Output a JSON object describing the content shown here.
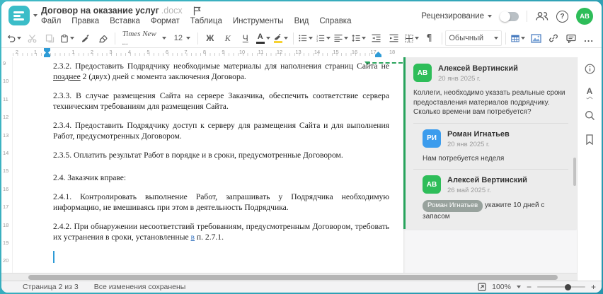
{
  "titlebar": {
    "doc_title": "Договор на оказание услуг",
    "doc_ext": ".docx",
    "menu": [
      "Файл",
      "Правка",
      "Вставка",
      "Формат",
      "Таблица",
      "Инструменты",
      "Вид",
      "Справка"
    ],
    "review_label": "Рецензирование",
    "avatar_initials": "АВ",
    "avatar_color": "#2ebd59"
  },
  "toolbar": {
    "font_name": "Times New ...",
    "font_size": "12",
    "bold_label": "Ж",
    "italic_label": "К",
    "underline_label": "Ч",
    "font_color_label": "А",
    "style_name": "Обычный",
    "pilcrow": "¶",
    "more_label": "..."
  },
  "icons": {
    "logo": "hamburger-lines",
    "flag-icon": "flag-outline",
    "undo-icon": "arrow-ccw",
    "cut-icon": "scissors",
    "copy-icon": "two-pages",
    "paste-icon": "clipboard",
    "format-painter-icon": "brush",
    "clear-style-icon": "eraser",
    "bullet-list-icon": "dots-lines",
    "numbered-list-icon": "digits-lines",
    "align-icon": "left-lines",
    "line-spacing-icon": "arrow-lines",
    "outdent-icon": "arrow-left-lines",
    "indent-icon": "arrow-right-lines",
    "shading-icon": "dashed-box",
    "table-icon": "blue-grid",
    "image-icon": "blue-picture",
    "link-icon": "chain",
    "comment-icon": "speech-bubble",
    "people-icon": "two-users",
    "help-icon": "?",
    "info-icon": "i-circle",
    "spellcheck-icon": "A-wavy",
    "search-icon": "magnifier",
    "bookmark-icon": "bookmark",
    "fit-width-icon": "square-diagonal-arrow"
  },
  "hruler": {
    "left_numbers": [
      "2",
      "1"
    ],
    "numbers": [
      "1",
      "2",
      "3",
      "4",
      "5",
      "6",
      "7",
      "8",
      "9",
      "10",
      "11",
      "12",
      "13",
      "14",
      "15",
      "16",
      "17",
      "18"
    ]
  },
  "vruler": {
    "numbers": [
      "9",
      "10",
      "11",
      "12",
      "13",
      "14",
      "15",
      "16",
      "17",
      "18",
      "19",
      "20"
    ]
  },
  "document": {
    "paragraphs": [
      {
        "gap": false,
        "segments": [
          {
            "t": "2.3.2. Предоставить Подрядчику необходимые материалы для наполнения страниц Сайта не ",
            "s": ""
          },
          {
            "t": "позднее",
            "s": "u"
          },
          {
            "t": " 2 (двух) дней с момента заключения Договора.",
            "s": ""
          }
        ]
      },
      {
        "gap": false,
        "segments": [
          {
            "t": "2.3.3. В случае размещения Сайта на сервере Заказчика, обеспечить соответствие сервера техническим требованиям для размещения Сайта.",
            "s": ""
          }
        ]
      },
      {
        "gap": false,
        "segments": [
          {
            "t": "2.3.4. Предоставить Подрядчику доступ к серверу для размещения Сайта и для выполнения Работ, предусмотренных Договором.",
            "s": ""
          }
        ]
      },
      {
        "gap": false,
        "segments": [
          {
            "t": "2.3.5. Оплатить результат Работ в порядке и в сроки, предусмотренные Договором.",
            "s": ""
          }
        ]
      },
      {
        "gap": true,
        "segments": [
          {
            "t": "2.4. Заказчик вправе:",
            "s": ""
          }
        ]
      },
      {
        "gap": false,
        "segments": [
          {
            "t": "2.4.1. Контролировать выполнение Работ, запрашивать у Подрядчика необходимую информацию, не вмешиваясь при этом в деятельность Подрядчика.",
            "s": ""
          }
        ]
      },
      {
        "gap": false,
        "segments": [
          {
            "t": "2.4.2. При обнаружении несоответствий требованиям, предусмотренным Договором, требовать их устранения в сроки, установленные ",
            "s": ""
          },
          {
            "t": "в",
            "s": "link"
          },
          {
            "t": " п. 2.7.1.",
            "s": ""
          }
        ]
      }
    ]
  },
  "comments": {
    "items": [
      {
        "initials": "АВ",
        "color": "#2ebd59",
        "name": "Алексей Вертинский",
        "date": "20 янв 2025 г.",
        "text": "Коллеги, необходимо указать реальные сроки предоставления материалов подрядчику. Сколько времени вам потребуется?",
        "reply": false
      },
      {
        "initials": "РИ",
        "color": "#3b9ced",
        "name": "Роман Игнатьев",
        "date": "20 янв 2025 г.",
        "text": "Нам потребуется неделя",
        "reply": true
      },
      {
        "initials": "АВ",
        "color": "#2ebd59",
        "name": "Алексей Вертинский",
        "date": "26 май 2025 г.",
        "mention": "Роман Игнатьев",
        "text": "укажите 10 дней с запасом",
        "reply": true
      }
    ]
  },
  "statusbar": {
    "page_label": "Страница 2 из 3",
    "saved_label": "Все изменения сохранены",
    "zoom_value": "100%",
    "zoom_minus": "−",
    "zoom_plus": "+"
  }
}
